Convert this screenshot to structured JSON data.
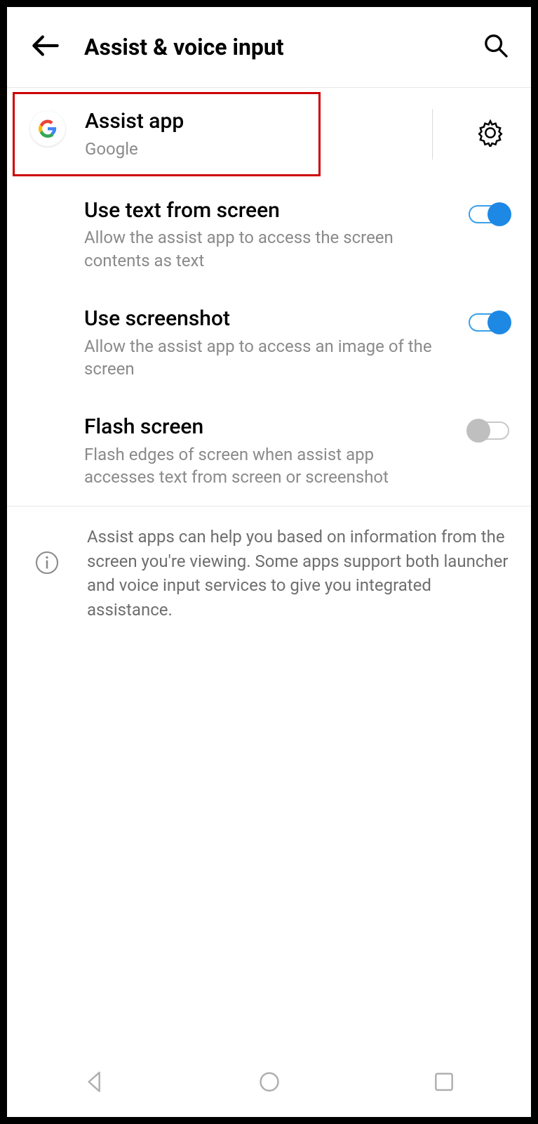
{
  "header": {
    "title": "Assist & voice input"
  },
  "assist": {
    "title": "Assist app",
    "subtitle": "Google"
  },
  "settings": [
    {
      "title": "Use text from screen",
      "subtitle": "Allow the assist app to access the screen contents as text",
      "enabled": true
    },
    {
      "title": "Use screenshot",
      "subtitle": "Allow the assist app to access an image of the screen",
      "enabled": true
    },
    {
      "title": "Flash screen",
      "subtitle": "Flash edges of screen when assist app accesses text from screen or screenshot",
      "enabled": false
    }
  ],
  "info": "Assist apps can help you based on information from the screen you're viewing. Some apps support both launcher and voice input services to give you integrated assistance."
}
